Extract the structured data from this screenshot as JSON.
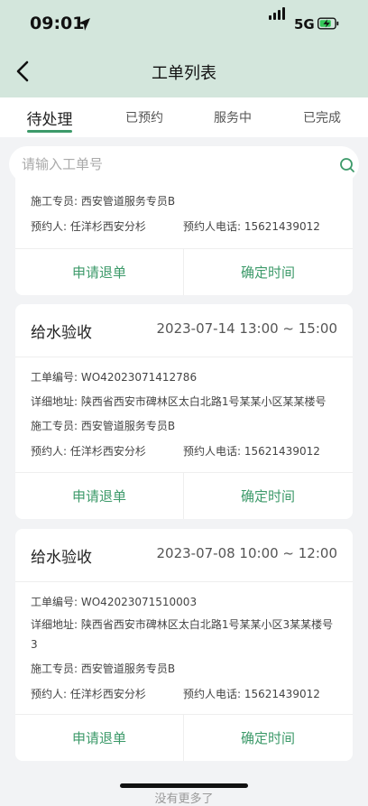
{
  "status": {
    "time": "09:01",
    "network": "5G"
  },
  "header": {
    "title": "工单列表"
  },
  "tabs": [
    {
      "label": "待处理"
    },
    {
      "label": "已预约"
    },
    {
      "label": "服务中"
    },
    {
      "label": "已完成"
    }
  ],
  "search": {
    "placeholder": "请输入工单号"
  },
  "labels": {
    "order_no": "工单编号:",
    "address": "详细地址:",
    "staff": "施工专员:",
    "booker": "预约人:",
    "booker_phone": "预约人电话:"
  },
  "orders": [
    {
      "staff": "西安管道服务专员B",
      "booker": "任洋杉西安分杉",
      "phone": "15621439012",
      "cancel_label": "申请退单",
      "confirm_label": "确定时间"
    },
    {
      "type": "给水验收",
      "time": "2023-07-14 13:00 ~ 15:00",
      "order_no": "WO42023071412786",
      "address": "陕西省西安市碑林区太白北路1号某某小区某某楼号",
      "staff": "西安管道服务专员B",
      "booker": "任洋杉西安分杉",
      "phone": "15621439012",
      "cancel_label": "申请退单",
      "confirm_label": "确定时间"
    },
    {
      "type": "给水验收",
      "time": "2023-07-08 10:00 ~ 12:00",
      "order_no": "WO42023071510003",
      "address": "陕西省西安市碑林区太白北路1号某某小区3某某楼号3",
      "staff": "西安管道服务专员B",
      "booker": "任洋杉西安分杉",
      "phone": "15621439012",
      "cancel_label": "申请退单",
      "confirm_label": "确定时间"
    }
  ],
  "footer": {
    "no_more": "没有更多了"
  }
}
